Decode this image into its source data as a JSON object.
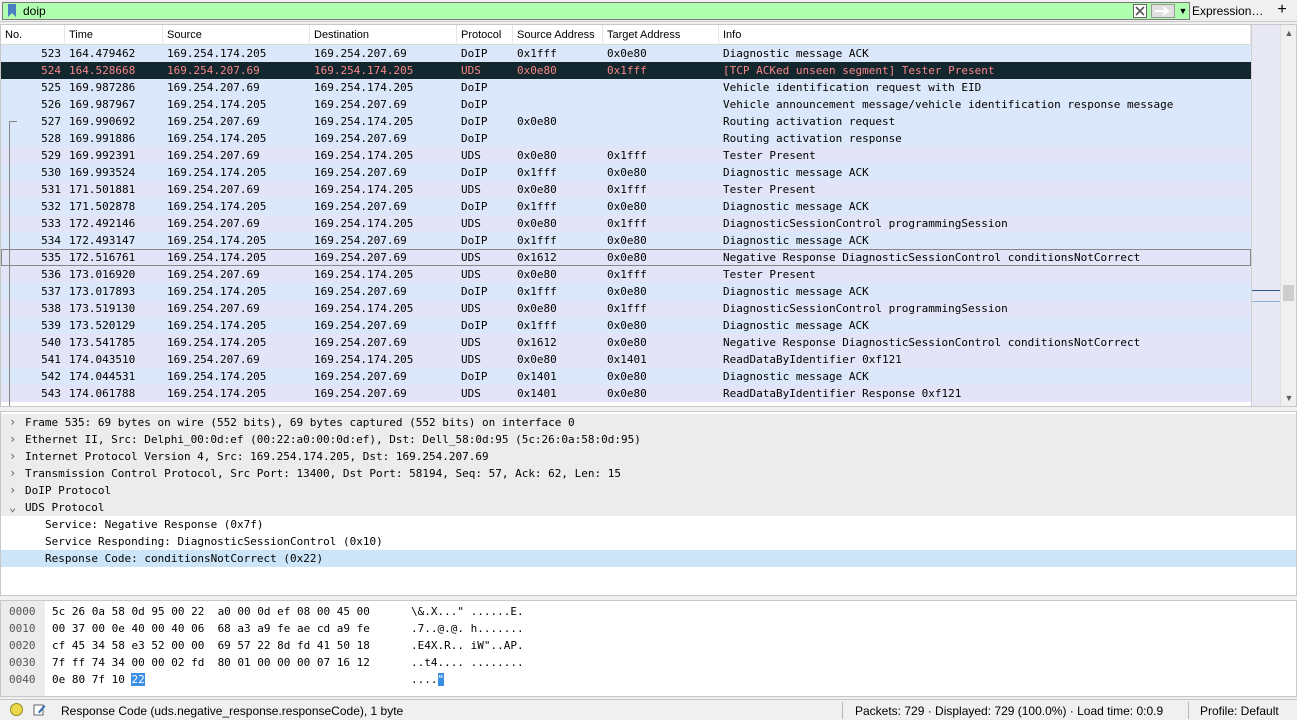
{
  "filter": {
    "value": "doip",
    "expression_label": "Expression…",
    "plus_label": "+"
  },
  "columns": [
    "No.",
    "Time",
    "Source",
    "Destination",
    "Protocol",
    "Source Address",
    "Target Address",
    "Info"
  ],
  "packets": [
    {
      "no": "523",
      "time": "164.479462",
      "src": "169.254.174.205",
      "dst": "169.254.207.69",
      "proto": "DoIP",
      "saddr": "0x1fff",
      "taddr": "0x0e80",
      "info": "Diagnostic message ACK"
    },
    {
      "no": "524",
      "time": "164.528668",
      "src": "169.254.207.69",
      "dst": "169.254.174.205",
      "proto": "UDS",
      "saddr": "0x0e80",
      "taddr": "0x1fff",
      "info": "[TCP ACKed unseen segment] Tester Present"
    },
    {
      "no": "525",
      "time": "169.987286",
      "src": "169.254.207.69",
      "dst": "169.254.174.205",
      "proto": "DoIP",
      "saddr": "",
      "taddr": "",
      "info": "Vehicle identification request with EID"
    },
    {
      "no": "526",
      "time": "169.987967",
      "src": "169.254.174.205",
      "dst": "169.254.207.69",
      "proto": "DoIP",
      "saddr": "",
      "taddr": "",
      "info": "Vehicle announcement message/vehicle identification response message"
    },
    {
      "no": "527",
      "time": "169.990692",
      "src": "169.254.207.69",
      "dst": "169.254.174.205",
      "proto": "DoIP",
      "saddr": "0x0e80",
      "taddr": "",
      "info": "Routing activation request"
    },
    {
      "no": "528",
      "time": "169.991886",
      "src": "169.254.174.205",
      "dst": "169.254.207.69",
      "proto": "DoIP",
      "saddr": "",
      "taddr": "",
      "info": "Routing activation response"
    },
    {
      "no": "529",
      "time": "169.992391",
      "src": "169.254.207.69",
      "dst": "169.254.174.205",
      "proto": "UDS",
      "saddr": "0x0e80",
      "taddr": "0x1fff",
      "info": "Tester Present"
    },
    {
      "no": "530",
      "time": "169.993524",
      "src": "169.254.174.205",
      "dst": "169.254.207.69",
      "proto": "DoIP",
      "saddr": "0x1fff",
      "taddr": "0x0e80",
      "info": "Diagnostic message ACK"
    },
    {
      "no": "531",
      "time": "171.501881",
      "src": "169.254.207.69",
      "dst": "169.254.174.205",
      "proto": "UDS",
      "saddr": "0x0e80",
      "taddr": "0x1fff",
      "info": "Tester Present"
    },
    {
      "no": "532",
      "time": "171.502878",
      "src": "169.254.174.205",
      "dst": "169.254.207.69",
      "proto": "DoIP",
      "saddr": "0x1fff",
      "taddr": "0x0e80",
      "info": "Diagnostic message ACK"
    },
    {
      "no": "533",
      "time": "172.492146",
      "src": "169.254.207.69",
      "dst": "169.254.174.205",
      "proto": "UDS",
      "saddr": "0x0e80",
      "taddr": "0x1fff",
      "info": "DiagnosticSessionControl programmingSession"
    },
    {
      "no": "534",
      "time": "172.493147",
      "src": "169.254.174.205",
      "dst": "169.254.207.69",
      "proto": "DoIP",
      "saddr": "0x1fff",
      "taddr": "0x0e80",
      "info": "Diagnostic message ACK"
    },
    {
      "no": "535",
      "time": "172.516761",
      "src": "169.254.174.205",
      "dst": "169.254.207.69",
      "proto": "UDS",
      "saddr": "0x1612",
      "taddr": "0x0e80",
      "info": "Negative Response DiagnosticSessionControl conditionsNotCorrect"
    },
    {
      "no": "536",
      "time": "173.016920",
      "src": "169.254.207.69",
      "dst": "169.254.174.205",
      "proto": "UDS",
      "saddr": "0x0e80",
      "taddr": "0x1fff",
      "info": "Tester Present"
    },
    {
      "no": "537",
      "time": "173.017893",
      "src": "169.254.174.205",
      "dst": "169.254.207.69",
      "proto": "DoIP",
      "saddr": "0x1fff",
      "taddr": "0x0e80",
      "info": "Diagnostic message ACK"
    },
    {
      "no": "538",
      "time": "173.519130",
      "src": "169.254.207.69",
      "dst": "169.254.174.205",
      "proto": "UDS",
      "saddr": "0x0e80",
      "taddr": "0x1fff",
      "info": "DiagnosticSessionControl programmingSession"
    },
    {
      "no": "539",
      "time": "173.520129",
      "src": "169.254.174.205",
      "dst": "169.254.207.69",
      "proto": "DoIP",
      "saddr": "0x1fff",
      "taddr": "0x0e80",
      "info": "Diagnostic message ACK"
    },
    {
      "no": "540",
      "time": "173.541785",
      "src": "169.254.174.205",
      "dst": "169.254.207.69",
      "proto": "UDS",
      "saddr": "0x1612",
      "taddr": "0x0e80",
      "info": "Negative Response DiagnosticSessionControl conditionsNotCorrect"
    },
    {
      "no": "541",
      "time": "174.043510",
      "src": "169.254.207.69",
      "dst": "169.254.174.205",
      "proto": "UDS",
      "saddr": "0x0e80",
      "taddr": "0x1401",
      "info": "ReadDataByIdentifier 0xf121"
    },
    {
      "no": "542",
      "time": "174.044531",
      "src": "169.254.174.205",
      "dst": "169.254.207.69",
      "proto": "DoIP",
      "saddr": "0x1401",
      "taddr": "0x0e80",
      "info": "Diagnostic message ACK"
    },
    {
      "no": "543",
      "time": "174.061788",
      "src": "169.254.174.205",
      "dst": "169.254.207.69",
      "proto": "UDS",
      "saddr": "0x1401",
      "taddr": "0x0e80",
      "info": "ReadDataByIdentifier Response 0xf121"
    }
  ],
  "details": [
    {
      "text": "Frame 535: 69 bytes on wire (552 bits), 69 bytes captured (552 bits) on interface 0",
      "expanded": false
    },
    {
      "text": "Ethernet II, Src: Delphi_00:0d:ef (00:22:a0:00:0d:ef), Dst: Dell_58:0d:95 (5c:26:0a:58:0d:95)",
      "expanded": false
    },
    {
      "text": "Internet Protocol Version 4, Src: 169.254.174.205, Dst: 169.254.207.69",
      "expanded": false
    },
    {
      "text": "Transmission Control Protocol, Src Port: 13400, Dst Port: 58194, Seq: 57, Ack: 62, Len: 15",
      "expanded": false
    },
    {
      "text": "DoIP Protocol",
      "expanded": false
    },
    {
      "text": "UDS Protocol",
      "expanded": true
    }
  ],
  "uds_children": [
    "Service: Negative Response (0x7f)",
    "Service Responding: DiagnosticSessionControl (0x10)",
    "Response Code: conditionsNotCorrect (0x22)"
  ],
  "bytes": [
    {
      "offset": "0000",
      "hex": "5c 26 0a 58 0d 95 00 22  a0 00 0d ef 08 00 45 00",
      "ascii": "\\&.X...\" ......E."
    },
    {
      "offset": "0010",
      "hex": "00 37 00 0e 40 00 40 06  68 a3 a9 fe ae cd a9 fe",
      "ascii": ".7..@.@. h......."
    },
    {
      "offset": "0020",
      "hex": "cf 45 34 58 e3 52 00 00  69 57 22 8d fd 41 50 18",
      "ascii": ".E4X.R.. iW\"..AP."
    },
    {
      "offset": "0030",
      "hex": "7f ff 74 34 00 00 02 fd  80 01 00 00 00 07 16 12",
      "ascii": "..t4.... ........"
    },
    {
      "offset": "0040",
      "hex_plain": "0e 80 7f 10 ",
      "hex_sel": "22",
      "ascii_plain": "....",
      "ascii_sel": "\""
    }
  ],
  "status": {
    "field": "Response Code (uds.negative_response.responseCode), 1 byte",
    "packets": "Packets: 729 · Displayed: 729 (100.0%) · Load time: 0:0.9",
    "profile": "Profile: Default"
  }
}
